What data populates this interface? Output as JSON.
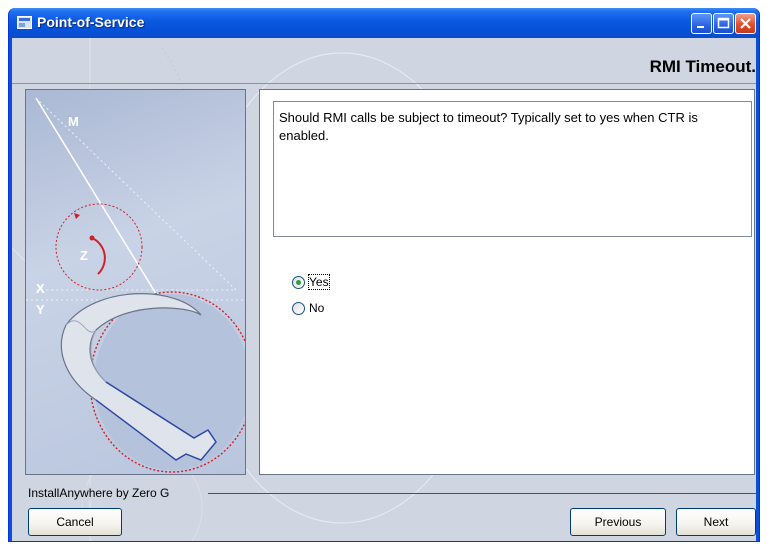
{
  "window": {
    "title": "Point-of-Service",
    "icon": "installer-app-icon",
    "controls": [
      "minimize-icon",
      "maximize-icon",
      "close-icon"
    ],
    "titlebar_color": "#0a58e0",
    "close_color": "#e0502a"
  },
  "step": {
    "title": "RMI Timeout."
  },
  "content": {
    "description": "Should RMI calls be subject to timeout? Typically set to yes when CTR is enabled.",
    "options": [
      {
        "label": "Yes",
        "selected": true
      },
      {
        "label": "No",
        "selected": false
      }
    ]
  },
  "illustration": {
    "labels": {
      "m": "M",
      "z": "Z",
      "x": "X",
      "y": "Y"
    },
    "accent_color": "#d0202a"
  },
  "footer": {
    "vendor": "InstallAnywhere by Zero G",
    "cancel_label": "Cancel",
    "previous_label": "Previous",
    "next_label": "Next"
  }
}
